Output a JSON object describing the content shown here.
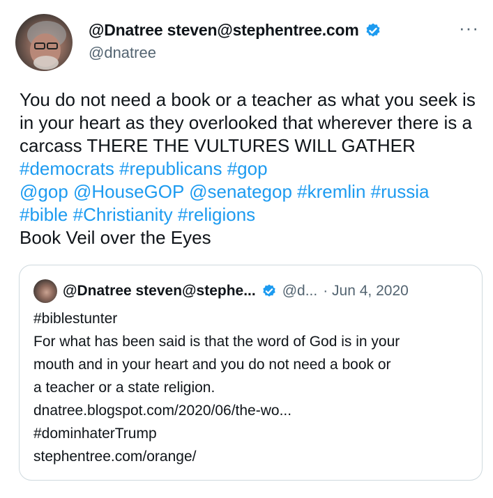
{
  "tweet": {
    "display_name": "@Dnatree steven@stephentree.com",
    "handle": "@dnatree",
    "more_icon": "more-dots-icon",
    "verified_color": "#1d9bf0",
    "text_plain_1": "You do not need a book or a teacher as what you seek is in your heart as they overlooked that wherever there is a carcass THERE THE VULTURES WILL GATHER ",
    "hashtags_line1": "#democrats #republicans #gop",
    "mentions_line": "@gop @HouseGOP @senategop #kremlin #russia",
    "hashtags_line2": "#bible #Christianity #religions",
    "text_plain_2": "Book Veil over the Eyes"
  },
  "quote": {
    "display_name": "@Dnatree steven@stephe...",
    "handle": "@d...",
    "date": "· Jun 4, 2020",
    "lines": [
      "#biblestunter",
      "For what has been said is that the word of God is in your",
      "mouth and in your heart and you do not need a book or",
      "a teacher or a state religion.",
      " dnatree.blogspot.com/2020/06/the-wo...",
      "#dominhaterTrump",
      "stephentree.com/orange/"
    ]
  },
  "colors": {
    "link": "#1d9bf0",
    "secondary_text": "#536471",
    "border": "#cfd9de"
  }
}
